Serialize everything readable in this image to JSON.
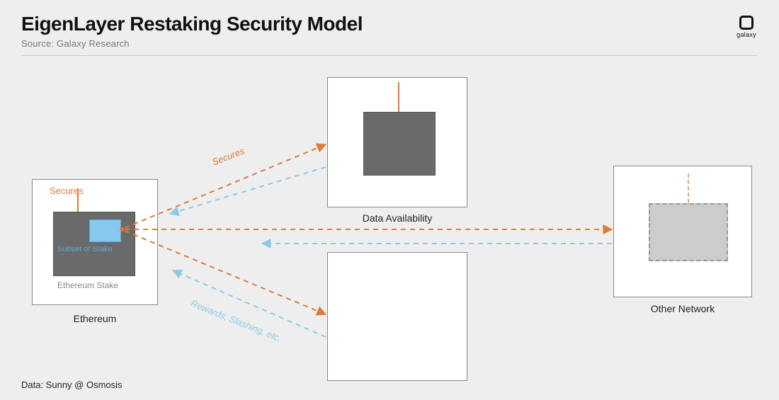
{
  "header": {
    "title": "EigenLayer Restaking Security Model",
    "source": "Source: Galaxy Research"
  },
  "logo": {
    "text": "galaxy"
  },
  "footer": {
    "credit": "Data: Sunny @ Osmosis"
  },
  "nodes": {
    "ethereum": {
      "label": "Ethereum",
      "secures_label": "Secures",
      "stake_label": "Ethereum Stake",
      "subset_label": "Subset of Stake"
    },
    "data_availability": {
      "label": "Data Availability"
    },
    "other_network": {
      "label": "Other Network"
    },
    "middle_blank": {
      "label": ""
    }
  },
  "edges": {
    "secures_top": "Secures",
    "rewards_bottom": "Rewards, Slashing, etc."
  },
  "colors": {
    "orange": "#e07a3a",
    "blue": "#8ecae6",
    "gray_dark": "#6a6a6a",
    "gray_light": "#cccccc"
  }
}
